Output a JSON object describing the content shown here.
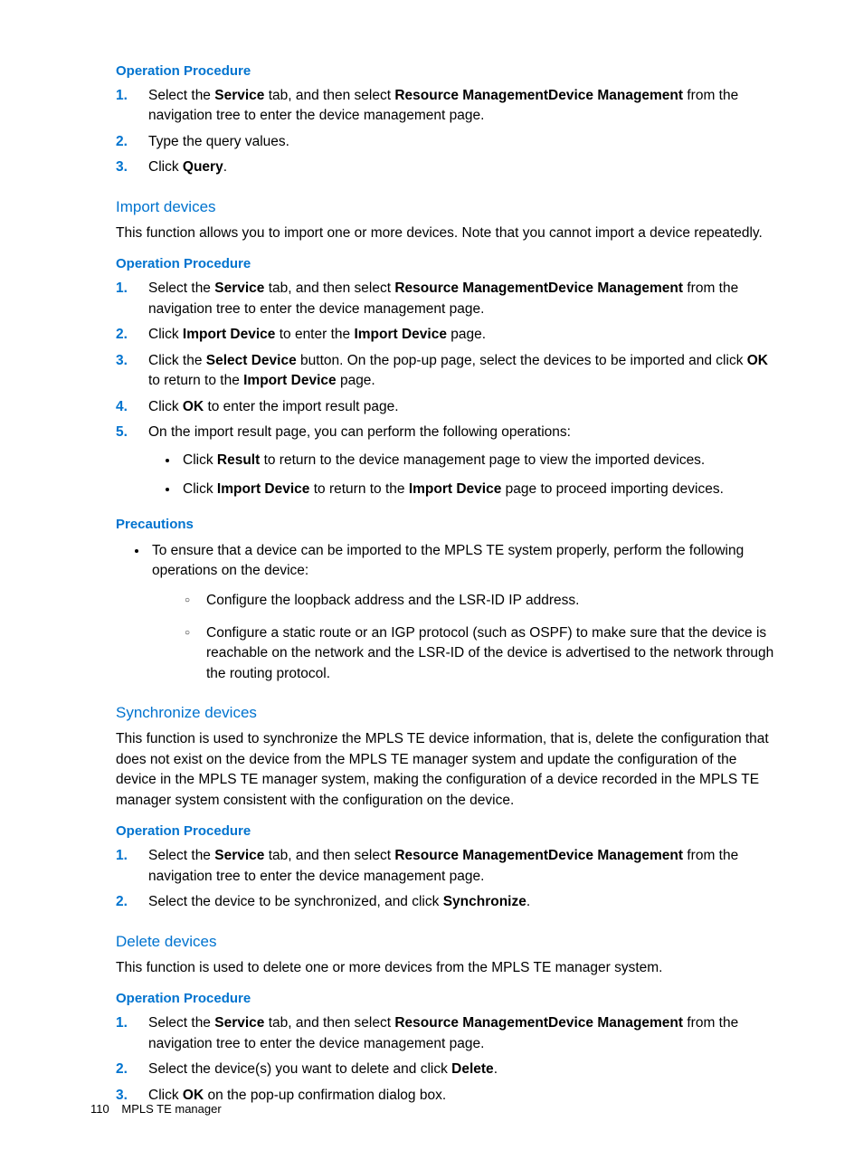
{
  "sec1": {
    "heading": "Operation Procedure",
    "steps": [
      [
        {
          "t": "Select the "
        },
        {
          "t": "Service",
          "b": true
        },
        {
          "t": " tab, and then select "
        },
        {
          "t": "Resource Management",
          "b": true
        },
        {
          "t": "Device Management",
          "b": true
        },
        {
          "t": " from the navigation tree to enter the device management page."
        }
      ],
      [
        {
          "t": "Type the query values."
        }
      ],
      [
        {
          "t": "Click "
        },
        {
          "t": "Query",
          "b": true
        },
        {
          "t": "."
        }
      ]
    ]
  },
  "import": {
    "title": "Import devices",
    "desc": "This function allows you to import one or more devices. Note that you cannot import a device repeatedly.",
    "op_heading": "Operation Procedure",
    "steps": [
      [
        {
          "t": "Select the "
        },
        {
          "t": "Service",
          "b": true
        },
        {
          "t": " tab, and then select "
        },
        {
          "t": "Resource Management",
          "b": true
        },
        {
          "t": "Device Management",
          "b": true
        },
        {
          "t": " from the navigation tree to enter the device management page."
        }
      ],
      [
        {
          "t": "Click "
        },
        {
          "t": "Import Device",
          "b": true
        },
        {
          "t": " to enter the "
        },
        {
          "t": "Import Device",
          "b": true
        },
        {
          "t": " page."
        }
      ],
      [
        {
          "t": "Click the "
        },
        {
          "t": "Select Device",
          "b": true
        },
        {
          "t": " button. On the pop-up page, select the devices to be imported and click "
        },
        {
          "t": "OK",
          "b": true
        },
        {
          "t": " to return to the "
        },
        {
          "t": "Import Device",
          "b": true
        },
        {
          "t": " page."
        }
      ],
      [
        {
          "t": "Click "
        },
        {
          "t": "OK",
          "b": true
        },
        {
          "t": " to enter the import result page."
        }
      ],
      [
        {
          "t": "On the import result page, you can perform the following operations:"
        }
      ]
    ],
    "sub_bullets": [
      [
        {
          "t": "Click "
        },
        {
          "t": "Result",
          "b": true
        },
        {
          "t": " to return to the device management page to view the imported devices."
        }
      ],
      [
        {
          "t": "Click "
        },
        {
          "t": "Import Device",
          "b": true
        },
        {
          "t": " to return to the "
        },
        {
          "t": "Import Device",
          "b": true
        },
        {
          "t": " page to proceed importing devices."
        }
      ]
    ],
    "precautions_heading": "Precautions",
    "precaution_intro": "To ensure that a device can be imported to the MPLS TE system properly, perform the following operations on the device:",
    "precaution_items": [
      "Configure the loopback address and the LSR-ID IP address.",
      "Configure a static route or an IGP protocol (such as OSPF) to make sure that the device is reachable on the network and the LSR-ID of the device is advertised to the network through the routing protocol."
    ]
  },
  "sync": {
    "title": "Synchronize devices",
    "desc": "This function is used to synchronize the MPLS TE device information, that is, delete the configuration that does not exist on the device from the MPLS TE manager system and update the configuration of the device in the MPLS TE manager system, making the configuration of a device recorded in the MPLS TE manager system consistent with the configuration on the device.",
    "op_heading": "Operation Procedure",
    "steps": [
      [
        {
          "t": "Select the "
        },
        {
          "t": "Service",
          "b": true
        },
        {
          "t": " tab, and then select "
        },
        {
          "t": "Resource Management",
          "b": true
        },
        {
          "t": "Device Management",
          "b": true
        },
        {
          "t": " from the navigation tree to enter the device management page."
        }
      ],
      [
        {
          "t": "Select the device to be synchronized, and click "
        },
        {
          "t": "Synchronize",
          "b": true
        },
        {
          "t": "."
        }
      ]
    ]
  },
  "delete": {
    "title": "Delete devices",
    "desc": "This function is used to delete one or more devices from the MPLS TE manager system.",
    "op_heading": "Operation Procedure",
    "steps": [
      [
        {
          "t": "Select the "
        },
        {
          "t": "Service",
          "b": true
        },
        {
          "t": " tab, and then select "
        },
        {
          "t": "Resource Management",
          "b": true
        },
        {
          "t": "Device Management",
          "b": true
        },
        {
          "t": " from the navigation tree to enter the device management page."
        }
      ],
      [
        {
          "t": "Select the device(s) you want to delete and click "
        },
        {
          "t": "Delete",
          "b": true
        },
        {
          "t": "."
        }
      ],
      [
        {
          "t": "Click "
        },
        {
          "t": "OK",
          "b": true
        },
        {
          "t": " on the pop-up confirmation dialog box."
        }
      ]
    ]
  },
  "footer": {
    "page_number": "110",
    "title": "MPLS TE manager"
  }
}
